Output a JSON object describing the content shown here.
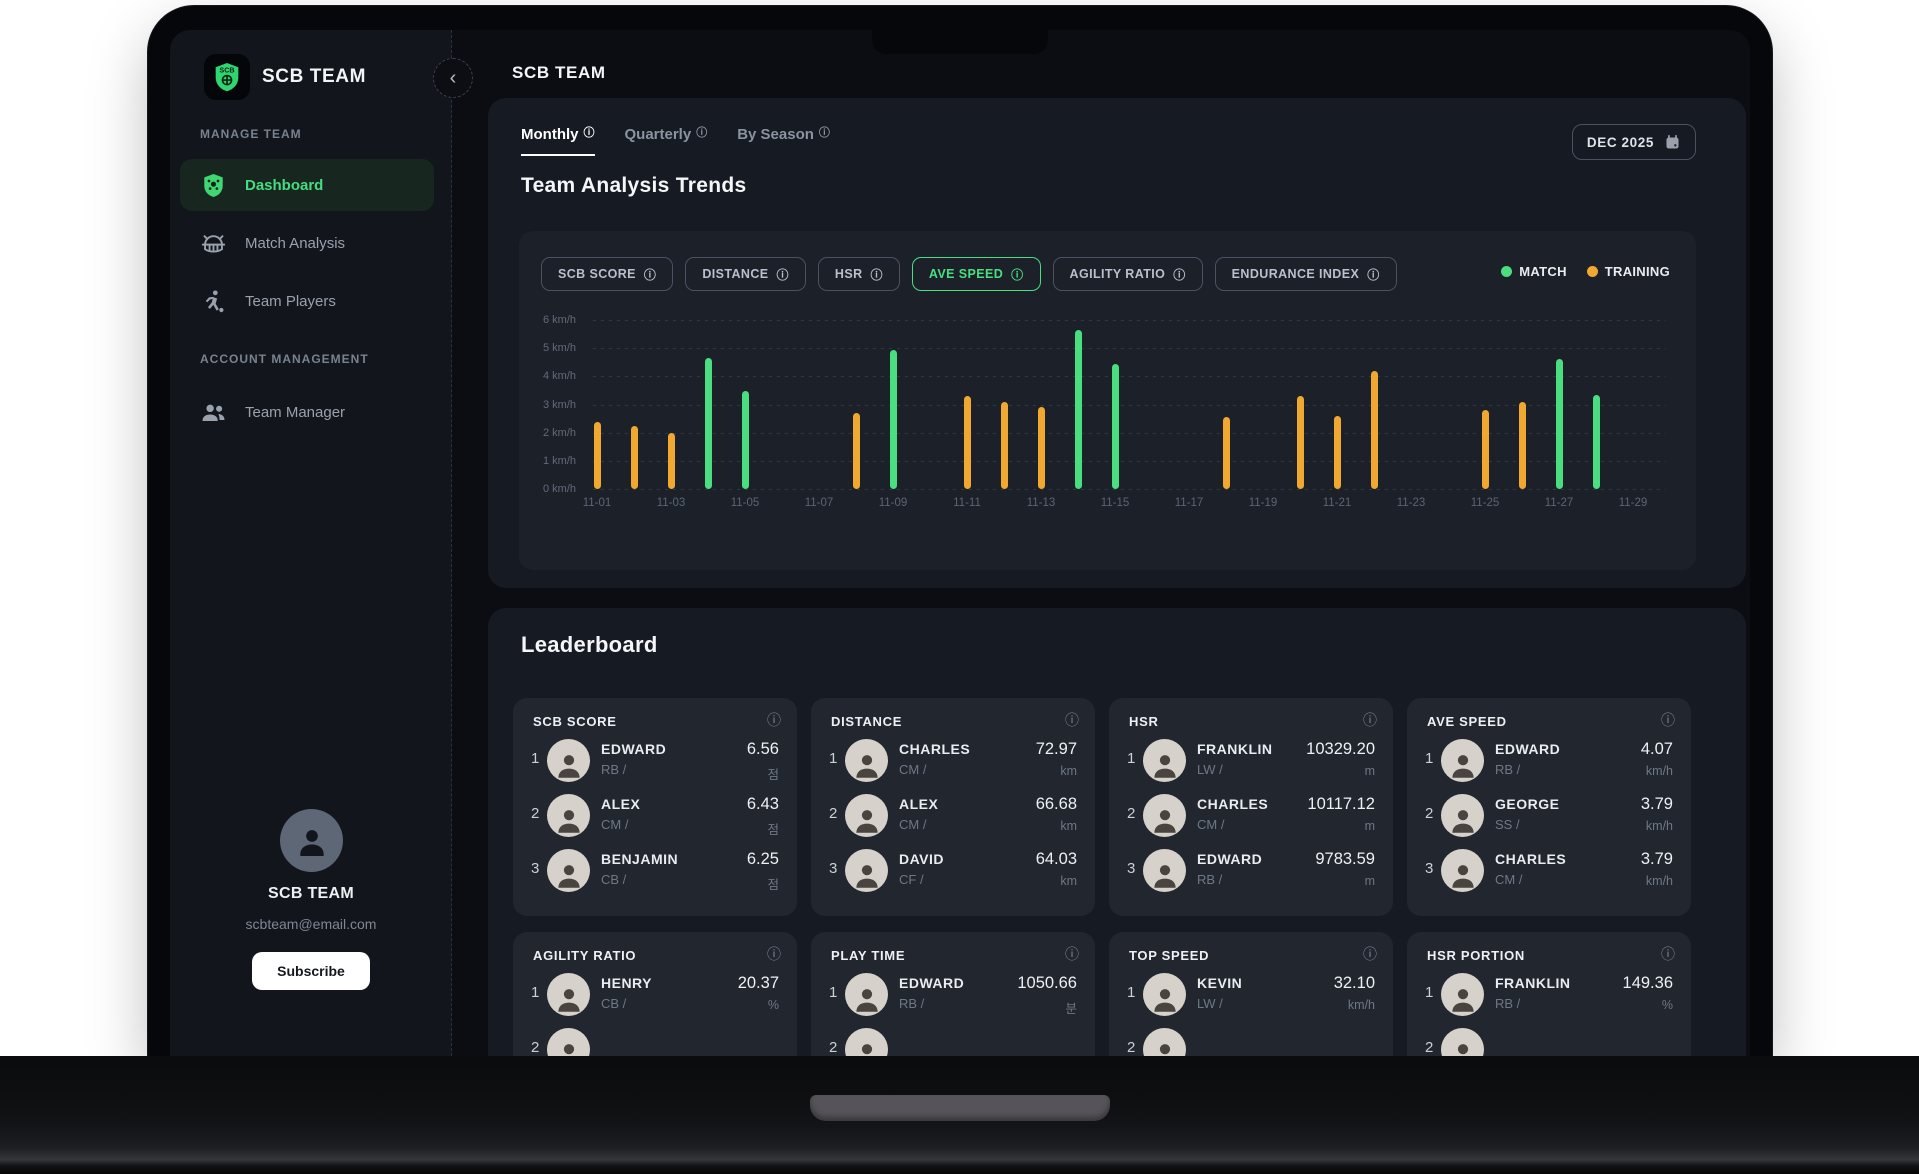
{
  "window": {
    "header_title": "SCB TEAM"
  },
  "sidebar": {
    "team_name": "SCB TEAM",
    "collapse_icon": "chevron-left-icon",
    "sections": [
      {
        "label": "MANAGE TEAM",
        "items": [
          {
            "label": "Dashboard",
            "icon": "shield-soccer-icon",
            "active": true
          },
          {
            "label": "Match Analysis",
            "icon": "stadium-icon",
            "active": false
          },
          {
            "label": "Team Players",
            "icon": "soccer-player-icon",
            "active": false
          }
        ]
      },
      {
        "label": "ACCOUNT MANAGEMENT",
        "items": [
          {
            "label": "Team Manager",
            "icon": "people-icon",
            "active": false
          }
        ]
      }
    ],
    "profile": {
      "avatar_icon": "person-icon",
      "name": "SCB TEAM",
      "email": "scbteam@email.com",
      "subscribe_label": "Subscribe"
    }
  },
  "trends": {
    "tabs": [
      {
        "label": "Monthly",
        "active": true
      },
      {
        "label": "Quarterly",
        "active": false
      },
      {
        "label": "By Season",
        "active": false
      }
    ],
    "date_button": {
      "label": "DEC 2025",
      "icon": "calendar-icon"
    },
    "title": "Team Analysis Trends",
    "metrics": [
      {
        "label": "SCB SCORE",
        "active": false
      },
      {
        "label": "DISTANCE",
        "active": false
      },
      {
        "label": "HSR",
        "active": false
      },
      {
        "label": "AVE SPEED",
        "active": true
      },
      {
        "label": "AGILITY RATIO",
        "active": false
      },
      {
        "label": "ENDURANCE INDEX",
        "active": false
      }
    ],
    "legend": [
      {
        "label": "MATCH",
        "color": "#4ade80"
      },
      {
        "label": "TRAINING",
        "color": "#f0a830"
      }
    ]
  },
  "chart_data": {
    "type": "bar",
    "title": "Team Analysis Trends - AVE SPEED",
    "unit": "km/h",
    "ylim": [
      0,
      6
    ],
    "y_ticks": [
      "6 km/h",
      "5 km/h",
      "4 km/h",
      "3 km/h",
      "2 km/h",
      "1 km/h",
      "0 km/h"
    ],
    "x_tick_labels": [
      "11-01",
      "11-03",
      "11-05",
      "11-07",
      "11-09",
      "11-11",
      "11-13",
      "11-15",
      "11-17",
      "11-19",
      "11-21",
      "11-23",
      "11-25",
      "11-27",
      "11-29"
    ],
    "grid": "horizontal-dashed",
    "legend_position": "top-right",
    "series": [
      {
        "name": "MATCH",
        "color": "#4ade80",
        "points": [
          {
            "date": "11-04",
            "value": 4.65
          },
          {
            "date": "11-05",
            "value": 3.5
          },
          {
            "date": "11-09",
            "value": 4.95
          },
          {
            "date": "11-14",
            "value": 5.65
          },
          {
            "date": "11-15",
            "value": 4.45
          },
          {
            "date": "11-27",
            "value": 4.6
          },
          {
            "date": "11-28",
            "value": 3.35
          }
        ]
      },
      {
        "name": "TRAINING",
        "color": "#f0a830",
        "points": [
          {
            "date": "11-01",
            "value": 2.4
          },
          {
            "date": "11-02",
            "value": 2.25
          },
          {
            "date": "11-03",
            "value": 2.0
          },
          {
            "date": "11-08",
            "value": 2.7
          },
          {
            "date": "11-11",
            "value": 3.3
          },
          {
            "date": "11-12",
            "value": 3.1
          },
          {
            "date": "11-13",
            "value": 2.9
          },
          {
            "date": "11-18",
            "value": 2.55
          },
          {
            "date": "11-20",
            "value": 3.3
          },
          {
            "date": "11-21",
            "value": 2.6
          },
          {
            "date": "11-22",
            "value": 4.2
          },
          {
            "date": "11-25",
            "value": 2.8
          },
          {
            "date": "11-26",
            "value": 3.1
          }
        ]
      }
    ]
  },
  "leaderboard": {
    "title": "Leaderboard",
    "cards": [
      {
        "title": "SCB SCORE",
        "rows": [
          {
            "rank": "1",
            "name": "EDWARD",
            "position": "RB /",
            "value": "6.56",
            "unit": "점"
          },
          {
            "rank": "2",
            "name": "ALEX",
            "position": "CM /",
            "value": "6.43",
            "unit": "점"
          },
          {
            "rank": "3",
            "name": "BENJAMIN",
            "position": "CB /",
            "value": "6.25",
            "unit": "점"
          }
        ]
      },
      {
        "title": "DISTANCE",
        "rows": [
          {
            "rank": "1",
            "name": "CHARLES",
            "position": "CM /",
            "value": "72.97",
            "unit": "km"
          },
          {
            "rank": "2",
            "name": "ALEX",
            "position": "CM /",
            "value": "66.68",
            "unit": "km"
          },
          {
            "rank": "3",
            "name": "DAVID",
            "position": "CF /",
            "value": "64.03",
            "unit": "km"
          }
        ]
      },
      {
        "title": "HSR",
        "rows": [
          {
            "rank": "1",
            "name": "FRANKLIN",
            "position": "LW /",
            "value": "10329.20",
            "unit": "m"
          },
          {
            "rank": "2",
            "name": "CHARLES",
            "position": "CM /",
            "value": "10117.12",
            "unit": "m"
          },
          {
            "rank": "3",
            "name": "EDWARD",
            "position": "RB /",
            "value": "9783.59",
            "unit": "m"
          }
        ]
      },
      {
        "title": "AVE SPEED",
        "rows": [
          {
            "rank": "1",
            "name": "EDWARD",
            "position": "RB /",
            "value": "4.07",
            "unit": "km/h"
          },
          {
            "rank": "2",
            "name": "GEORGE",
            "position": "SS /",
            "value": "3.79",
            "unit": "km/h"
          },
          {
            "rank": "3",
            "name": "CHARLES",
            "position": "CM /",
            "value": "3.79",
            "unit": "km/h"
          }
        ]
      },
      {
        "title": "AGILITY RATIO",
        "rows": [
          {
            "rank": "1",
            "name": "HENRY",
            "position": "CB /",
            "value": "20.37",
            "unit": "%"
          }
        ]
      },
      {
        "title": "PLAY TIME",
        "rows": [
          {
            "rank": "1",
            "name": "EDWARD",
            "position": "RB /",
            "value": "1050.66",
            "unit": "분"
          }
        ]
      },
      {
        "title": "TOP SPEED",
        "rows": [
          {
            "rank": "1",
            "name": "KEVIN",
            "position": "LW /",
            "value": "32.10",
            "unit": "km/h"
          }
        ]
      },
      {
        "title": "HSR PORTION",
        "rows": [
          {
            "rank": "1",
            "name": "FRANKLIN",
            "position": "RB /",
            "value": "149.36",
            "unit": "%"
          }
        ]
      }
    ]
  },
  "colors": {
    "accent_green": "#4ade80",
    "accent_orange": "#f0a830",
    "screen_bg": "#0b0d12",
    "panel_bg": "#161a22",
    "card_bg": "#21262f"
  }
}
